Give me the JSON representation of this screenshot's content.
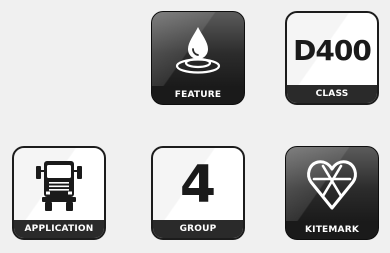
{
  "tiles": {
    "feature": {
      "label": "FEATURE",
      "icon": "water-drop-icon"
    },
    "class": {
      "label": "CLASS",
      "value": "D400"
    },
    "application": {
      "label": "APPLICATION",
      "icon": "truck-icon"
    },
    "group": {
      "label": "GROUP",
      "value": "4"
    },
    "kitemark": {
      "label": "KITEMARK",
      "icon": "kitemark-icon"
    }
  },
  "colors": {
    "dark_tile": "#2c2c2c",
    "label_bar": "#1a1a1a",
    "light_tile": "#ffffff"
  }
}
